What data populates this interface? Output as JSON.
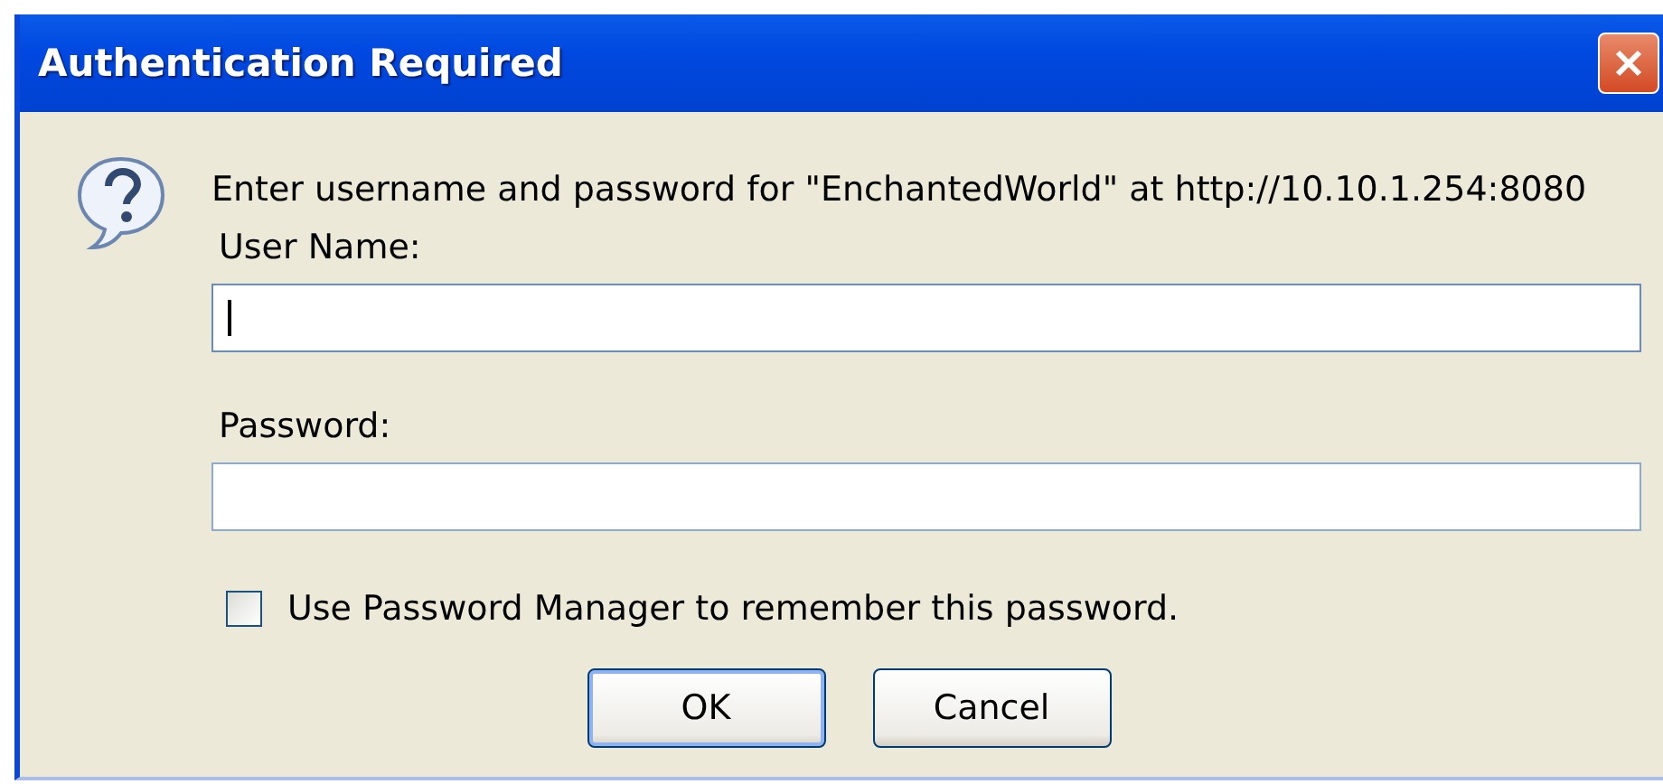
{
  "window": {
    "title": "Authentication Required"
  },
  "message": "Enter username and password for \"EnchantedWorld\" at http://10.10.1.254:8080",
  "fields": [
    {
      "label": "User Name:",
      "focused": true
    },
    {
      "label": "Password:",
      "focused": false
    }
  ],
  "remember": {
    "label": "Use Password Manager to remember this password.",
    "checked": false
  },
  "buttons": [
    {
      "label": "OK",
      "default": true
    },
    {
      "label": "Cancel",
      "default": false
    }
  ]
}
